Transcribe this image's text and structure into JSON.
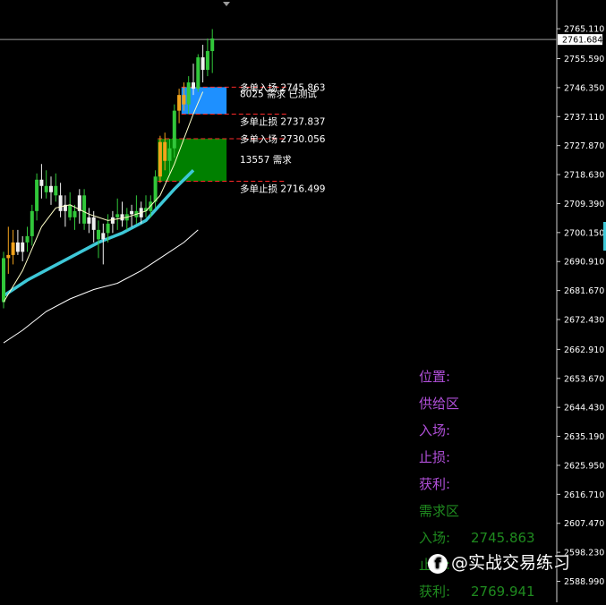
{
  "chart_data": {
    "type": "candlestick",
    "price_axis": {
      "ticks": [
        "2765.110",
        "2755.590",
        "2746.350",
        "2737.110",
        "2727.870",
        "2718.630",
        "2709.390",
        "2700.150",
        "2690.910",
        "2681.670",
        "2672.430",
        "2662.910",
        "2653.670",
        "2644.430",
        "2635.190",
        "2625.950",
        "2616.710",
        "2607.470",
        "2598.230",
        "2588.990"
      ],
      "ylim": [
        2586,
        2768
      ],
      "current_price": "2761.684"
    },
    "colors": {
      "bull": "#31c73a",
      "bear": "#f0f0f0",
      "orange": "#f2a31b",
      "ma_fast": "#ffffc8",
      "ma_mid": "#3ec8d8",
      "ma_slow": "#ffffff",
      "supply_zone": "#1e90ff",
      "demand_zone": "#008000",
      "stop_line": "#ff2a2a",
      "panel_purple": "#b04fd8",
      "panel_green": "#1f8a1f"
    },
    "candles": [
      {
        "o": 2678,
        "h": 2694,
        "l": 2676,
        "c": 2692
      },
      {
        "o": 2692,
        "h": 2702,
        "l": 2687,
        "c": 2693
      },
      {
        "o": 2693,
        "h": 2701,
        "l": 2690,
        "c": 2697
      },
      {
        "o": 2697,
        "h": 2701,
        "l": 2693,
        "c": 2694
      },
      {
        "o": 2694,
        "h": 2699,
        "l": 2691,
        "c": 2697
      },
      {
        "o": 2697,
        "h": 2702,
        "l": 2694,
        "c": 2699
      },
      {
        "o": 2699,
        "h": 2709,
        "l": 2696,
        "c": 2707
      },
      {
        "o": 2707,
        "h": 2719,
        "l": 2704,
        "c": 2717
      },
      {
        "o": 2717,
        "h": 2722,
        "l": 2711,
        "c": 2715
      },
      {
        "o": 2715,
        "h": 2720,
        "l": 2711,
        "c": 2713
      },
      {
        "o": 2713,
        "h": 2718,
        "l": 2709,
        "c": 2715
      },
      {
        "o": 2715,
        "h": 2719,
        "l": 2710,
        "c": 2712
      },
      {
        "o": 2712,
        "h": 2716,
        "l": 2705,
        "c": 2707
      },
      {
        "o": 2707,
        "h": 2712,
        "l": 2702,
        "c": 2709
      },
      {
        "o": 2709,
        "h": 2713,
        "l": 2704,
        "c": 2705
      },
      {
        "o": 2705,
        "h": 2709,
        "l": 2701,
        "c": 2707
      },
      {
        "o": 2707,
        "h": 2714,
        "l": 2703,
        "c": 2712
      },
      {
        "o": 2712,
        "h": 2714,
        "l": 2701,
        "c": 2703
      },
      {
        "o": 2703,
        "h": 2708,
        "l": 2700,
        "c": 2705
      },
      {
        "o": 2705,
        "h": 2707,
        "l": 2697,
        "c": 2701
      },
      {
        "o": 2701,
        "h": 2704,
        "l": 2692,
        "c": 2698
      },
      {
        "o": 2698,
        "h": 2703,
        "l": 2690,
        "c": 2700
      },
      {
        "o": 2700,
        "h": 2706,
        "l": 2697,
        "c": 2703
      },
      {
        "o": 2703,
        "h": 2707,
        "l": 2700,
        "c": 2705
      },
      {
        "o": 2705,
        "h": 2711,
        "l": 2701,
        "c": 2706
      },
      {
        "o": 2706,
        "h": 2710,
        "l": 2702,
        "c": 2704
      },
      {
        "o": 2704,
        "h": 2708,
        "l": 2701,
        "c": 2706
      },
      {
        "o": 2706,
        "h": 2709,
        "l": 2702,
        "c": 2707
      },
      {
        "o": 2707,
        "h": 2712,
        "l": 2703,
        "c": 2705
      },
      {
        "o": 2705,
        "h": 2710,
        "l": 2703,
        "c": 2708
      },
      {
        "o": 2708,
        "h": 2712,
        "l": 2705,
        "c": 2707
      },
      {
        "o": 2707,
        "h": 2712,
        "l": 2705,
        "c": 2710
      },
      {
        "o": 2710,
        "h": 2720,
        "l": 2708,
        "c": 2718
      },
      {
        "o": 2718,
        "h": 2731,
        "l": 2716,
        "c": 2729
      },
      {
        "o": 2729,
        "h": 2732,
        "l": 2720,
        "c": 2723
      },
      {
        "o": 2723,
        "h": 2730,
        "l": 2719,
        "c": 2727
      },
      {
        "o": 2727,
        "h": 2741,
        "l": 2724,
        "c": 2739
      },
      {
        "o": 2739,
        "h": 2746,
        "l": 2735,
        "c": 2744
      },
      {
        "o": 2744,
        "h": 2748,
        "l": 2739,
        "c": 2741
      },
      {
        "o": 2741,
        "h": 2750,
        "l": 2738,
        "c": 2748
      },
      {
        "o": 2748,
        "h": 2754,
        "l": 2744,
        "c": 2746
      },
      {
        "o": 2746,
        "h": 2757,
        "l": 2745,
        "c": 2756
      },
      {
        "o": 2756,
        "h": 2760,
        "l": 2748,
        "c": 2752
      },
      {
        "o": 2752,
        "h": 2762,
        "l": 2750,
        "c": 2758
      },
      {
        "o": 2758,
        "h": 2765,
        "l": 2751,
        "c": 2762
      }
    ],
    "candle_colors": [
      "bull",
      "orange",
      "orange",
      "bear",
      "bear",
      "bull",
      "bull",
      "bull",
      "bear",
      "bull",
      "bear",
      "bull",
      "bear",
      "bear",
      "bull",
      "bull",
      "bear",
      "bull",
      "bear",
      "bear",
      "bull",
      "bear",
      "bull",
      "bear",
      "bull",
      "bear",
      "bull",
      "bear",
      "bull",
      "bear",
      "bull",
      "bull",
      "bull",
      "orange",
      "orange",
      "bull",
      "bull",
      "orange",
      "orange",
      "bull",
      "bear",
      "bull",
      "bear",
      "bull",
      "bull"
    ],
    "ma_fast": [
      [
        0,
        2678
      ],
      [
        4,
        2688
      ],
      [
        8,
        2702
      ],
      [
        11,
        2708
      ],
      [
        14,
        2709
      ],
      [
        18,
        2706
      ],
      [
        22,
        2704
      ],
      [
        26,
        2705
      ],
      [
        30,
        2707
      ],
      [
        33,
        2712
      ],
      [
        36,
        2722
      ],
      [
        38,
        2730
      ],
      [
        40,
        2738
      ],
      [
        42,
        2745
      ]
    ],
    "ma_mid": [
      [
        0,
        2680
      ],
      [
        5,
        2685
      ],
      [
        10,
        2689
      ],
      [
        15,
        2693
      ],
      [
        20,
        2697
      ],
      [
        25,
        2700
      ],
      [
        30,
        2704
      ],
      [
        33,
        2709
      ],
      [
        36,
        2714
      ],
      [
        38,
        2717
      ],
      [
        40,
        2720
      ]
    ],
    "ma_slow": [
      [
        0,
        2665
      ],
      [
        4,
        2669
      ],
      [
        9,
        2675
      ],
      [
        14,
        2679
      ],
      [
        19,
        2682
      ],
      [
        24,
        2684
      ],
      [
        29,
        2688
      ],
      [
        34,
        2693
      ],
      [
        38,
        2697
      ],
      [
        41,
        2701
      ]
    ],
    "zones": [
      {
        "kind": "supply",
        "top": 2746.5,
        "bottom": 2737.9,
        "x_start": 37.5,
        "x_end": 47,
        "entry_label": "多单入场 2745.863",
        "sub_label": "8025 需求 已测试",
        "stop_label": "多单止损 2737.837"
      },
      {
        "kind": "demand",
        "top": 2730.056,
        "bottom": 2716.499,
        "x_start": 32.5,
        "x_end": 47,
        "entry_label": "多单入场 2730.056",
        "sub_label": "13557 需求",
        "stop_label": "多单止损 2716.499"
      }
    ]
  },
  "panel": {
    "rows": [
      {
        "key": "位置:",
        "value": "",
        "color": "purple"
      },
      {
        "key": "供给区",
        "value": "",
        "color": "purple"
      },
      {
        "key": "入场:",
        "value": "",
        "color": "purple"
      },
      {
        "key": "止损:",
        "value": "",
        "color": "purple"
      },
      {
        "key": "获利:",
        "value": "",
        "color": "purple"
      },
      {
        "key": "需求区",
        "value": "",
        "color": "green"
      },
      {
        "key": "入场:",
        "value": "2745.863",
        "color": "green"
      },
      {
        "key": "止损:",
        "value": "",
        "color": "green"
      },
      {
        "key": "获利:",
        "value": "2769.941",
        "color": "green"
      }
    ]
  },
  "watermark": {
    "text": "@实战交易练习",
    "icon": "facebook-icon"
  }
}
